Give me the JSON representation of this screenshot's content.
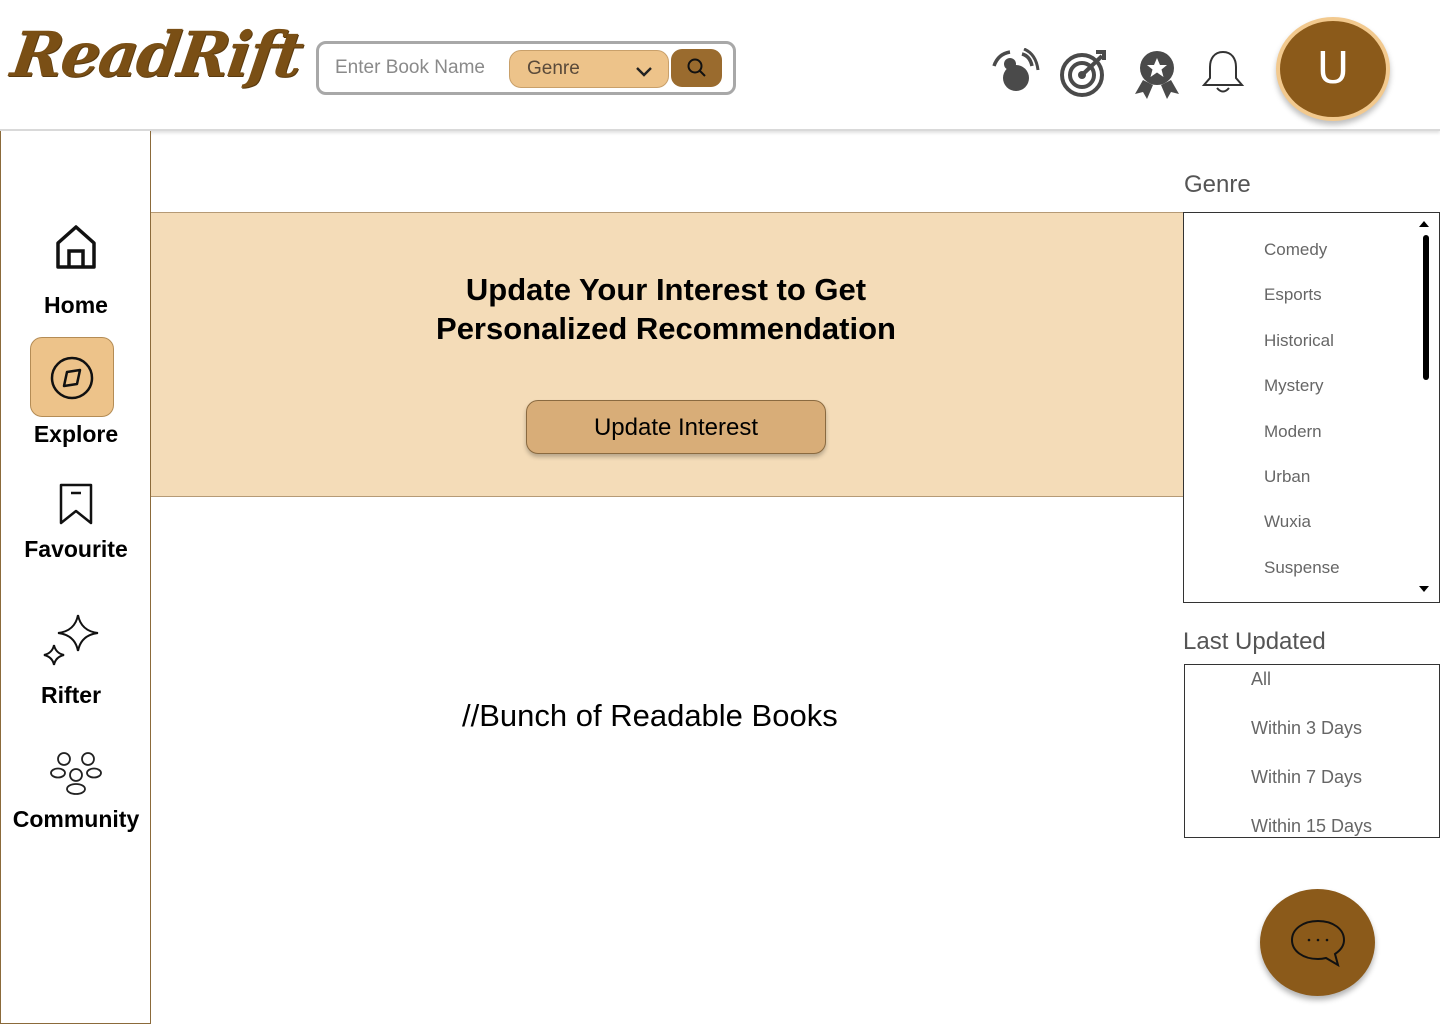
{
  "app": {
    "logo_text": "ReadRift"
  },
  "search": {
    "placeholder": "Enter Book Name",
    "genre_label": "Genre"
  },
  "header_icons": [
    "broadcast-icon",
    "target-icon",
    "award-icon",
    "bell-icon"
  ],
  "user": {
    "avatar_letter": "U"
  },
  "sidebar": {
    "items": [
      {
        "label": "Home",
        "icon": "home-icon"
      },
      {
        "label": "Explore",
        "icon": "compass-icon",
        "active": true
      },
      {
        "label": "Favourite",
        "icon": "bookmark-icon"
      },
      {
        "label": "Rifter",
        "icon": "sparkle-icon"
      },
      {
        "label": "Community",
        "icon": "community-icon"
      }
    ]
  },
  "banner": {
    "title_line1": "Update Your Interest to Get",
    "title_line2": "Personalized Recommendation",
    "button_label": "Update Interest"
  },
  "main": {
    "books_placeholder": "//Bunch of Readable Books"
  },
  "filters": {
    "genre": {
      "title": "Genre",
      "options": [
        "Comedy",
        "Esports",
        "Historical",
        "Mystery",
        "Modern",
        "Urban",
        "Wuxia",
        "Suspense"
      ]
    },
    "last_updated": {
      "title": "Last Updated",
      "options": [
        "All",
        "Within 3 Days",
        "Within 7 Days",
        "Within 15 Days"
      ]
    }
  },
  "colors": {
    "brand_brown": "#8b5a1a",
    "accent_tan": "#edc38a",
    "banner_bg": "#f4dcb8",
    "button_tan": "#d8ad78"
  }
}
